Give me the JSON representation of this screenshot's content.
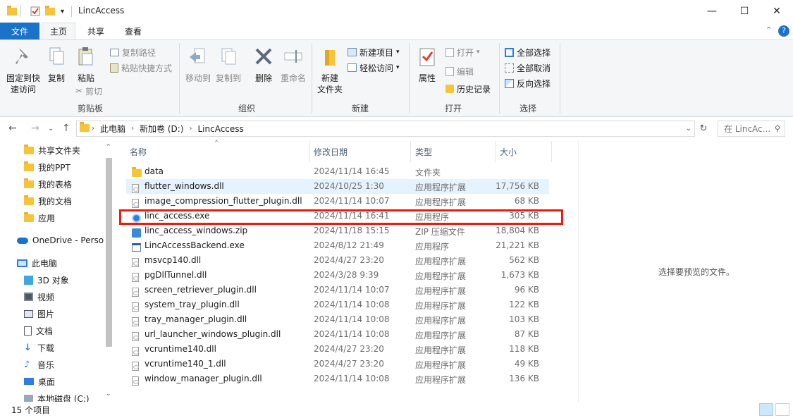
{
  "window": {
    "title": "LincAccess"
  },
  "ribbon_tabs": [
    "文件",
    "主页",
    "共享",
    "查看"
  ],
  "ribbon": {
    "clipboard": {
      "pin": "固定到快",
      "pin2": "速访问",
      "copy": "复制",
      "paste": "粘贴",
      "copy_path": "复制路径",
      "paste_shortcut": "粘贴快捷方式",
      "cut": "剪切",
      "label": "剪贴板"
    },
    "organize": {
      "move_to": "移动到",
      "copy_to": "复制到",
      "delete": "删除",
      "rename": "重命名",
      "label": "组织"
    },
    "new": {
      "new_folder": "新建",
      "new_folder2": "文件夹",
      "new_item": "新建项目",
      "easy_access": "轻松访问",
      "label": "新建"
    },
    "open": {
      "properties": "属性",
      "open": "打开",
      "edit": "编辑",
      "history": "历史记录",
      "label": "打开"
    },
    "select": {
      "select_all": "全部选择",
      "select_none": "全部取消",
      "invert": "反向选择",
      "label": "选择"
    }
  },
  "address": {
    "segments": [
      "此电脑",
      "新加卷 (D:)",
      "LincAccess"
    ]
  },
  "search": {
    "placeholder": "在 LincAc..."
  },
  "nav": {
    "items": [
      {
        "label": "共享文件夹",
        "icon": "shared-folder-icon"
      },
      {
        "label": "我的PPT",
        "icon": "folder-icon"
      },
      {
        "label": "我的表格",
        "icon": "folder-icon"
      },
      {
        "label": "我的文档",
        "icon": "folder-icon"
      },
      {
        "label": "应用",
        "icon": "folder-icon"
      },
      {
        "label": "OneDrive - Perso",
        "icon": "onedrive-icon"
      },
      {
        "label": "此电脑",
        "icon": "computer-icon"
      },
      {
        "label": "3D 对象",
        "icon": "3d-objects-icon"
      },
      {
        "label": "视频",
        "icon": "video-icon"
      },
      {
        "label": "图片",
        "icon": "picture-icon"
      },
      {
        "label": "文档",
        "icon": "document-icon"
      },
      {
        "label": "下载",
        "icon": "download-icon"
      },
      {
        "label": "音乐",
        "icon": "music-icon"
      },
      {
        "label": "桌面",
        "icon": "desktop-icon"
      },
      {
        "label": "本地磁盘 (C:)",
        "icon": "drive-icon"
      }
    ]
  },
  "columns": {
    "name": "名称",
    "date": "修改日期",
    "type": "类型",
    "size": "大小"
  },
  "files": [
    {
      "name": "data",
      "date": "2024/11/14 16:45",
      "type": "文件夹",
      "size": "",
      "icon": "folder"
    },
    {
      "name": "flutter_windows.dll",
      "date": "2024/10/25 1:30",
      "type": "应用程序扩展",
      "size": "17,756 KB",
      "icon": "dll"
    },
    {
      "name": "image_compression_flutter_plugin.dll",
      "date": "2024/11/14 10:07",
      "type": "应用程序扩展",
      "size": "68 KB",
      "icon": "dll"
    },
    {
      "name": "linc_access.exe",
      "date": "2024/11/14 16:41",
      "type": "应用程序",
      "size": "305 KB",
      "icon": "exe"
    },
    {
      "name": "linc_access_windows.zip",
      "date": "2024/11/18 15:15",
      "type": "ZIP 压缩文件",
      "size": "18,804 KB",
      "icon": "zip"
    },
    {
      "name": "LincAccessBackend.exe",
      "date": "2024/8/12 21:49",
      "type": "应用程序",
      "size": "21,221 KB",
      "icon": "app"
    },
    {
      "name": "msvcp140.dll",
      "date": "2024/4/27 23:20",
      "type": "应用程序扩展",
      "size": "562 KB",
      "icon": "dll"
    },
    {
      "name": "pgDllTunnel.dll",
      "date": "2024/3/28 9:39",
      "type": "应用程序扩展",
      "size": "1,673 KB",
      "icon": "dll"
    },
    {
      "name": "screen_retriever_plugin.dll",
      "date": "2024/11/14 10:07",
      "type": "应用程序扩展",
      "size": "96 KB",
      "icon": "dll"
    },
    {
      "name": "system_tray_plugin.dll",
      "date": "2024/11/14 10:08",
      "type": "应用程序扩展",
      "size": "122 KB",
      "icon": "dll"
    },
    {
      "name": "tray_manager_plugin.dll",
      "date": "2024/11/14 10:08",
      "type": "应用程序扩展",
      "size": "103 KB",
      "icon": "dll"
    },
    {
      "name": "url_launcher_windows_plugin.dll",
      "date": "2024/11/14 10:08",
      "type": "应用程序扩展",
      "size": "87 KB",
      "icon": "dll"
    },
    {
      "name": "vcruntime140.dll",
      "date": "2024/4/27 23:20",
      "type": "应用程序扩展",
      "size": "118 KB",
      "icon": "dll"
    },
    {
      "name": "vcruntime140_1.dll",
      "date": "2024/4/27 23:20",
      "type": "应用程序扩展",
      "size": "49 KB",
      "icon": "dll"
    },
    {
      "name": "window_manager_plugin.dll",
      "date": "2024/11/14 10:08",
      "type": "应用程序扩展",
      "size": "136 KB",
      "icon": "dll"
    }
  ],
  "preview": {
    "text": "选择要预览的文件。"
  },
  "status": {
    "count": "15 个项目"
  }
}
